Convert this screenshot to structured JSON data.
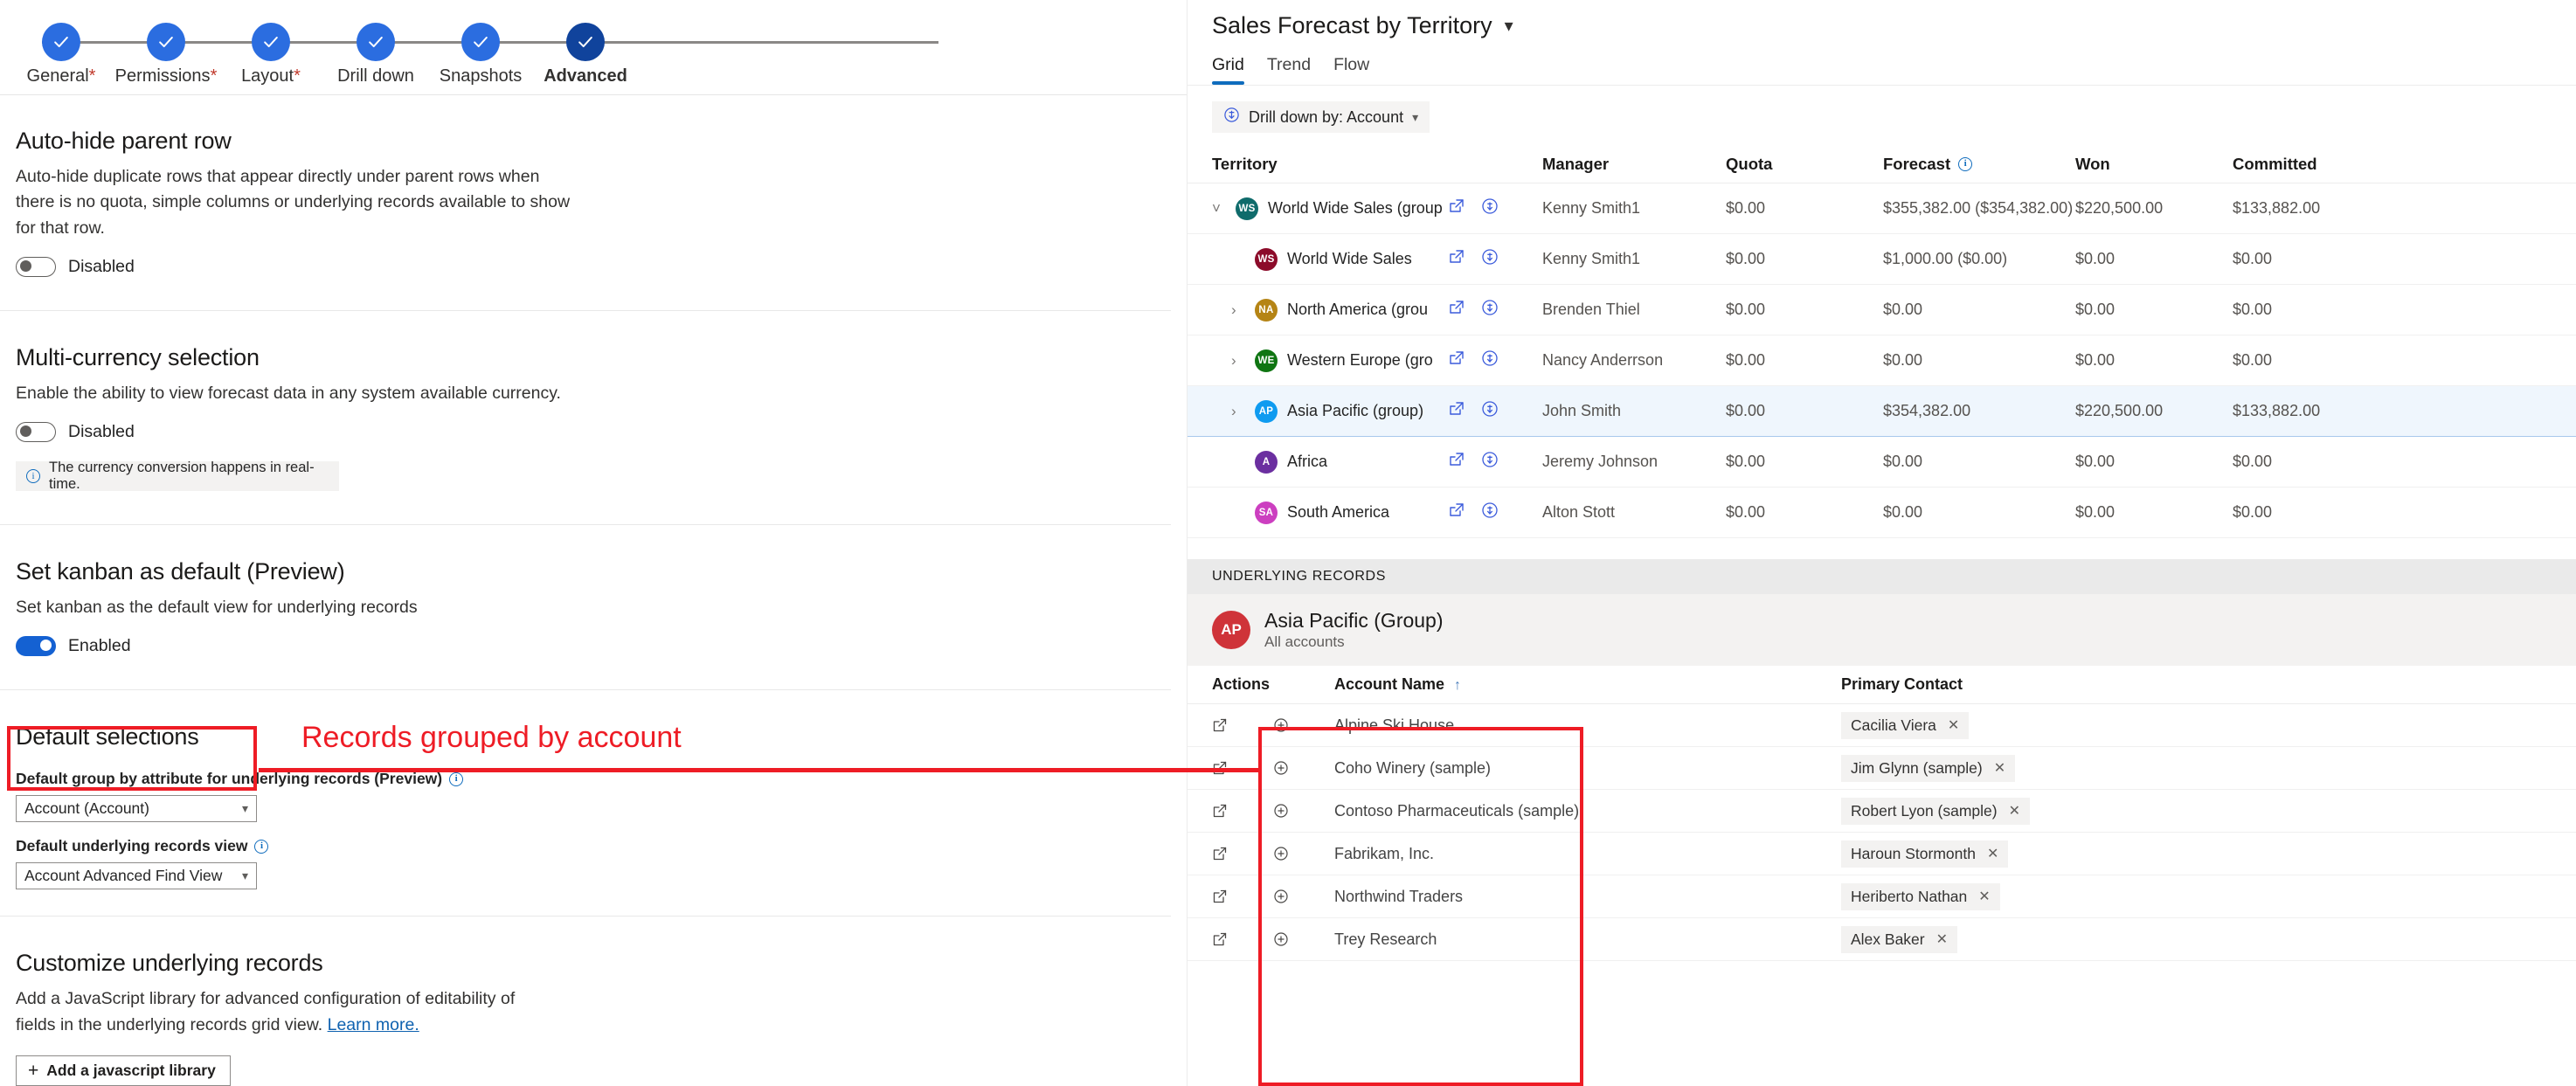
{
  "wizard": {
    "steps": [
      {
        "label": "General",
        "required": true,
        "current": false
      },
      {
        "label": "Permissions",
        "required": true,
        "current": false
      },
      {
        "label": "Layout",
        "required": true,
        "current": false
      },
      {
        "label": "Drill down",
        "required": false,
        "current": false
      },
      {
        "label": "Snapshots",
        "required": false,
        "current": false
      },
      {
        "label": "Advanced",
        "required": false,
        "current": true
      }
    ]
  },
  "settings": {
    "autohide": {
      "title": "Auto-hide parent row",
      "desc": "Auto-hide duplicate rows that appear directly under parent rows when there is no quota, simple columns or underlying records available to show for that row.",
      "toggle_state": "Disabled",
      "enabled": false
    },
    "multicurrency": {
      "title": "Multi-currency selection",
      "desc": "Enable the ability to view forecast data in any system available currency.",
      "toggle_state": "Disabled",
      "enabled": false,
      "info": "The currency conversion happens in real-time."
    },
    "kanban": {
      "title": "Set kanban as default (Preview)",
      "desc": "Set kanban as the default view for underlying records",
      "toggle_state": "Enabled",
      "enabled": true
    },
    "default_selections": {
      "title": "Default selections",
      "group_by_label": "Default group by attribute for underlying records (Preview)",
      "group_by_value": "Account (Account)",
      "view_label": "Default underlying records view",
      "view_value": "Account Advanced Find View"
    },
    "customize": {
      "title": "Customize underlying records",
      "desc_a": "Add a JavaScript library for advanced configuration of editability of fields in the underlying records grid view. ",
      "learn_more": "Learn more.",
      "add_button": "Add a javascript library"
    }
  },
  "annotation": {
    "note": "Records grouped by account",
    "color": "#ee1c25"
  },
  "forecast": {
    "title": "Sales Forecast by Territory",
    "tabs": [
      {
        "label": "Grid",
        "active": true
      },
      {
        "label": "Trend",
        "active": false
      },
      {
        "label": "Flow",
        "active": false
      }
    ],
    "drill_down": "Drill down by: Account",
    "columns": [
      "Territory",
      "",
      "Manager",
      "Quota",
      "Forecast",
      "Won",
      "Committed"
    ],
    "rows": [
      {
        "name": "World Wide Sales (group",
        "initials": "WS",
        "color": "#0f6b6b",
        "twist": "down",
        "indent": 0,
        "manager": "Kenny Smith1",
        "quota": "$0.00",
        "forecast": "$355,382.00 ($354,382.00)",
        "won": "$220,500.00",
        "committed": "$133,882.00",
        "selected": false
      },
      {
        "name": "World Wide Sales",
        "initials": "WS",
        "color": "#8c0b2a",
        "twist": "none",
        "indent": 1,
        "manager": "Kenny Smith1",
        "quota": "$0.00",
        "forecast": "$1,000.00 ($0.00)",
        "won": "$0.00",
        "committed": "$0.00",
        "selected": false
      },
      {
        "name": "North America (grou",
        "initials": "NA",
        "color": "#b58415",
        "twist": "right",
        "indent": 1,
        "manager": "Brenden Thiel",
        "quota": "$0.00",
        "forecast": "$0.00",
        "won": "$0.00",
        "committed": "$0.00",
        "selected": false
      },
      {
        "name": "Western Europe (gro",
        "initials": "WE",
        "color": "#0f7512",
        "twist": "right",
        "indent": 1,
        "manager": "Nancy Anderrson",
        "quota": "$0.00",
        "forecast": "$0.00",
        "won": "$0.00",
        "committed": "$0.00",
        "selected": false
      },
      {
        "name": "Asia Pacific (group)",
        "initials": "AP",
        "color": "#0f9bf0",
        "twist": "right",
        "indent": 1,
        "manager": "John Smith",
        "quota": "$0.00",
        "forecast": "$354,382.00",
        "won": "$220,500.00",
        "committed": "$133,882.00",
        "selected": true
      },
      {
        "name": "Africa",
        "initials": "A",
        "color": "#6b2fa0",
        "twist": "none",
        "indent": 1,
        "manager": "Jeremy Johnson",
        "quota": "$0.00",
        "forecast": "$0.00",
        "won": "$0.00",
        "committed": "$0.00",
        "selected": false
      },
      {
        "name": "South America",
        "initials": "SA",
        "color": "#cc3fc0",
        "twist": "none",
        "indent": 1,
        "manager": "Alton Stott",
        "quota": "$0.00",
        "forecast": "$0.00",
        "won": "$0.00",
        "committed": "$0.00",
        "selected": false
      }
    ]
  },
  "underlying": {
    "band_label": "UNDERLYING RECORDS",
    "group_initials": "AP",
    "group_name": "Asia Pacific (Group)",
    "group_sub": "All accounts",
    "columns": {
      "actions": "Actions",
      "account": "Account Name",
      "contact": "Primary Contact"
    },
    "rows": [
      {
        "account": "Alpine Ski House",
        "contact": "Cacilia Viera"
      },
      {
        "account": "Coho Winery (sample)",
        "contact": "Jim Glynn (sample)"
      },
      {
        "account": "Contoso Pharmaceuticals (sample)",
        "contact": "Robert Lyon (sample)"
      },
      {
        "account": "Fabrikam, Inc.",
        "contact": "Haroun Stormonth"
      },
      {
        "account": "Northwind Traders",
        "contact": "Heriberto Nathan"
      },
      {
        "account": "Trey Research",
        "contact": "Alex Baker"
      }
    ]
  }
}
